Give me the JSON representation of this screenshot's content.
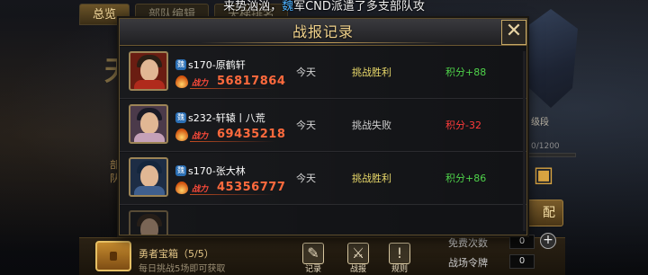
{
  "banner": {
    "part1": "来势汹汹，",
    "faction": "魏",
    "part2": "军CND派遣了多支部队攻"
  },
  "background": {
    "tabs": [
      {
        "label": "总览"
      },
      {
        "label": "部队编辑"
      },
      {
        "label": "天梯排名"
      }
    ],
    "big_char": "天",
    "side_text": "部队",
    "rank_text": "级段",
    "progress_text": "0/1200",
    "progress_fraction": 0.0,
    "config_button": "配"
  },
  "dialog": {
    "title": "战报记录",
    "close_icon": "close-icon",
    "records": [
      {
        "badge": "魏",
        "name": "s170-原鹤轩",
        "power_label": "战力",
        "power": "56817864",
        "day": "今天",
        "result": "挑战胜利",
        "result_color": "#e9d96a",
        "score": "积分+88",
        "score_color": "#4fd34a",
        "avatar": {
          "hair": "#2b1f15",
          "body": "#b02a1c",
          "bg": "#6a1d12"
        }
      },
      {
        "badge": "魏",
        "name": "s232-轩辕丨八荒",
        "power_label": "战力",
        "power": "69435218",
        "day": "今天",
        "result": "挑战失败",
        "result_color": "#cfcfcf",
        "score": "积分-32",
        "score_color": "#ff3b3b",
        "avatar": {
          "hair": "#1a1a26",
          "body": "#c5a1b8",
          "bg": "#4b3a4a"
        }
      },
      {
        "badge": "魏",
        "name": "s170-张大林",
        "power_label": "战力",
        "power": "45356777",
        "day": "今天",
        "result": "挑战胜利",
        "result_color": "#e9d96a",
        "score": "积分+86",
        "score_color": "#4fd34a",
        "avatar": {
          "hair": "#14263d",
          "body": "#3f5f8e",
          "bg": "#1d2d45"
        }
      }
    ]
  },
  "bottom": {
    "chest_title": "勇者宝箱（5/5）",
    "chest_desc": "每日挑战5场即可获取",
    "buttons": [
      {
        "label": "记录",
        "icon": "pencil-icon",
        "glyph": "✎"
      },
      {
        "label": "战报",
        "icon": "crossed-swords-icon",
        "glyph": "⚔"
      },
      {
        "label": "规则",
        "icon": "exclamation-icon",
        "glyph": "!"
      }
    ],
    "free_times_label": "免费次数",
    "free_times_value": "0",
    "battle_token_label": "战场令牌",
    "battle_token_value": "0"
  }
}
